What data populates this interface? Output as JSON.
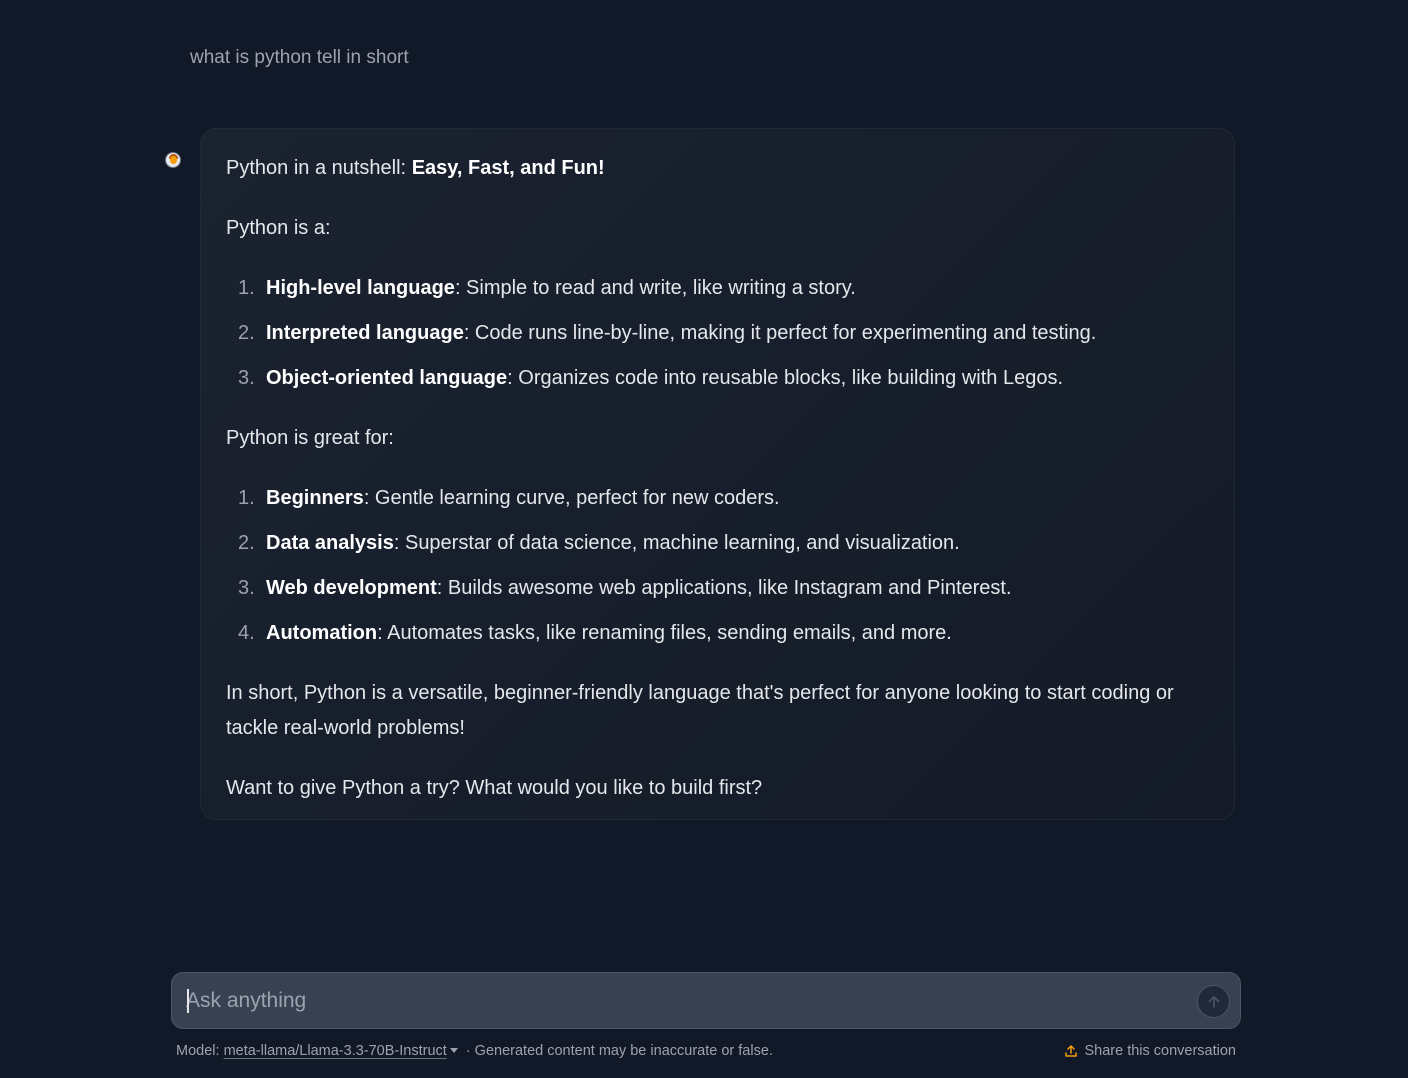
{
  "conversation": {
    "user_message": "what is python tell in short",
    "assistant": {
      "intro_plain": "Python in a nutshell: ",
      "intro_bold": "Easy, Fast, and Fun!",
      "section1_heading": "Python is a:",
      "list1": [
        {
          "num": "1.",
          "bold": "High-level language",
          "text": ": Simple to read and write, like writing a story."
        },
        {
          "num": "2.",
          "bold": "Interpreted language",
          "text": ": Code runs line-by-line, making it perfect for experimenting and testing."
        },
        {
          "num": "3.",
          "bold": "Object-oriented language",
          "text": ": Organizes code into reusable blocks, like building with Legos."
        }
      ],
      "section2_heading": "Python is great for:",
      "list2": [
        {
          "num": "1.",
          "bold": "Beginners",
          "text": ": Gentle learning curve, perfect for new coders."
        },
        {
          "num": "2.",
          "bold": "Data analysis",
          "text": ": Superstar of data science, machine learning, and visualization."
        },
        {
          "num": "3.",
          "bold": "Web development",
          "text": ": Builds awesome web applications, like Instagram and Pinterest."
        },
        {
          "num": "4.",
          "bold": "Automation",
          "text": ": Automates tasks, like renaming files, sending emails, and more."
        }
      ],
      "summary": "In short, Python is a versatile, beginner-friendly language that's perfect for anyone looking to start coding or tackle real-world problems!",
      "closing": "Want to give Python a try? What would you like to build first?"
    }
  },
  "composer": {
    "placeholder": "Ask anything",
    "value": ""
  },
  "footer": {
    "model_prefix": "Model: ",
    "model_name": "meta-llama/Llama-3.3-70B-Instruct",
    "disclaimer": " · Generated content may be inaccurate or false.",
    "share_label": "Share this conversation"
  },
  "icons": {
    "avatar": "assistant-avatar",
    "send": "arrow-up-icon",
    "share": "share-icon",
    "dropdown": "chevron-down-icon"
  },
  "colors": {
    "background": "#111827",
    "bubble": "#1b2230",
    "input": "#374151",
    "share_icon": "#f59e0b"
  }
}
